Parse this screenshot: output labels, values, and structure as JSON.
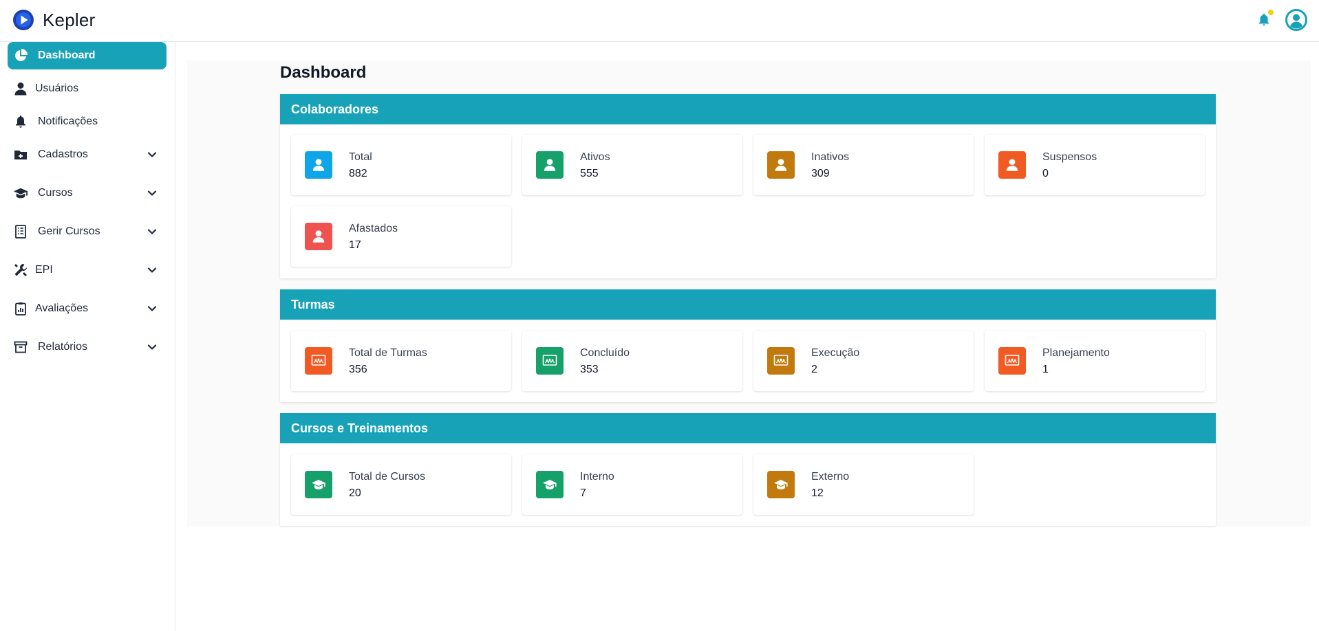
{
  "app": {
    "name": "Kepler"
  },
  "colors": {
    "accent": "#17a2b8",
    "blue": "#0ea5e9",
    "green": "#16a06a",
    "amber": "#c27a0e",
    "orange": "#f25a23",
    "red": "#ef5350",
    "notification_dot": "#facc15"
  },
  "sidebar": {
    "items": [
      {
        "label": "Dashboard",
        "icon": "pie-chart-icon",
        "active": true
      },
      {
        "label": "Usuários",
        "icon": "user-icon"
      },
      {
        "label": "Notificações",
        "icon": "bell-icon"
      },
      {
        "label": "Cadastros",
        "icon": "folder-plus-icon",
        "expandable": true
      },
      {
        "label": "Cursos",
        "icon": "graduation-cap-icon",
        "expandable": true
      },
      {
        "label": "Gerir Cursos",
        "icon": "checklist-icon",
        "expandable": true
      },
      {
        "label": "EPI",
        "icon": "tools-icon",
        "expandable": true
      },
      {
        "label": "Avaliações",
        "icon": "clipboard-chart-icon",
        "expandable": true
      },
      {
        "label": "Relatórios",
        "icon": "archive-icon",
        "expandable": true
      }
    ]
  },
  "main": {
    "title": "Dashboard",
    "sections": [
      {
        "title": "Colaboradores",
        "cards": [
          {
            "label": "Total",
            "value": "882",
            "icon": "user-icon",
            "color": "#0ea5e9"
          },
          {
            "label": "Ativos",
            "value": "555",
            "icon": "user-icon",
            "color": "#16a06a"
          },
          {
            "label": "Inativos",
            "value": "309",
            "icon": "user-icon",
            "color": "#c27a0e"
          },
          {
            "label": "Suspensos",
            "value": "0",
            "icon": "user-icon",
            "color": "#f25a23"
          },
          {
            "label": "Afastados",
            "value": "17",
            "icon": "user-icon",
            "color": "#ef5350"
          }
        ]
      },
      {
        "title": "Turmas",
        "cards": [
          {
            "label": "Total de Turmas",
            "value": "356",
            "icon": "classroom-icon",
            "color": "#f25a23"
          },
          {
            "label": "Concluído",
            "value": "353",
            "icon": "classroom-icon",
            "color": "#16a06a"
          },
          {
            "label": "Execução",
            "value": "2",
            "icon": "classroom-icon",
            "color": "#c27a0e"
          },
          {
            "label": "Planejamento",
            "value": "1",
            "icon": "classroom-icon",
            "color": "#f25a23"
          }
        ]
      },
      {
        "title": "Cursos e Treinamentos",
        "cards": [
          {
            "label": "Total de Cursos",
            "value": "20",
            "icon": "graduation-cap-icon",
            "color": "#16a06a"
          },
          {
            "label": "Interno",
            "value": "7",
            "icon": "graduation-cap-icon",
            "color": "#16a06a"
          },
          {
            "label": "Externo",
            "value": "12",
            "icon": "graduation-cap-icon",
            "color": "#c27a0e"
          }
        ]
      }
    ]
  }
}
